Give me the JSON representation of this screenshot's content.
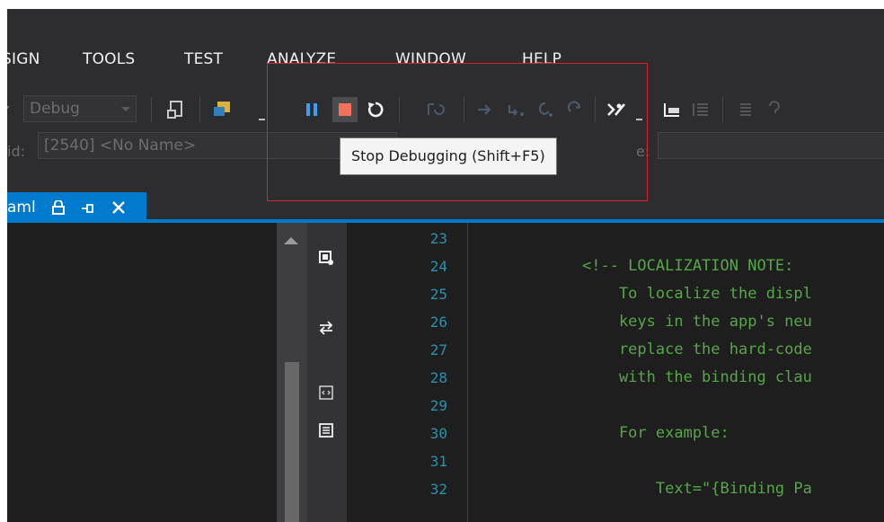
{
  "menu": {
    "items": [
      {
        "label": "SIGN"
      },
      {
        "label": "TOOLS"
      },
      {
        "label": "TEST"
      },
      {
        "label": "ANALYZE"
      },
      {
        "label": "WINDOW"
      },
      {
        "label": "HELP"
      }
    ]
  },
  "toolbar": {
    "config_combo": "Debug",
    "icons": [
      "attach-icon",
      "find-icon",
      "pause-icon",
      "stop-icon",
      "restart-icon",
      "show-next-statement-icon",
      "step-into-icon",
      "step-over-icon",
      "step-out-icon",
      "step-back-icon",
      "breakpoint-options-icon",
      "bookmark-icon",
      "indent-icon",
      "comment-icon"
    ],
    "colors": {
      "pause": "#3c9ff5",
      "stop": "#f0705a",
      "accent": "#007acc"
    }
  },
  "toolbar2": {
    "process_label": "id:",
    "process_value": "[2540] <No Name>",
    "frame_label_suffix": "e:"
  },
  "tooltip": {
    "text": "Stop Debugging (Shift+F5)"
  },
  "tab": {
    "name": "aml"
  },
  "editor": {
    "line_numbers": [
      "23",
      "24",
      "25",
      "26",
      "27",
      "28",
      "29",
      "30",
      "31",
      "32"
    ],
    "lines": [
      "",
      "<!-- LOCALIZATION NOTE:",
      "    To localize the displ",
      "    keys in the app's neu",
      "    replace the hard-code",
      "    with the binding clau",
      "",
      "    For example:",
      "",
      "        Text=\"{Binding Pa"
    ]
  }
}
